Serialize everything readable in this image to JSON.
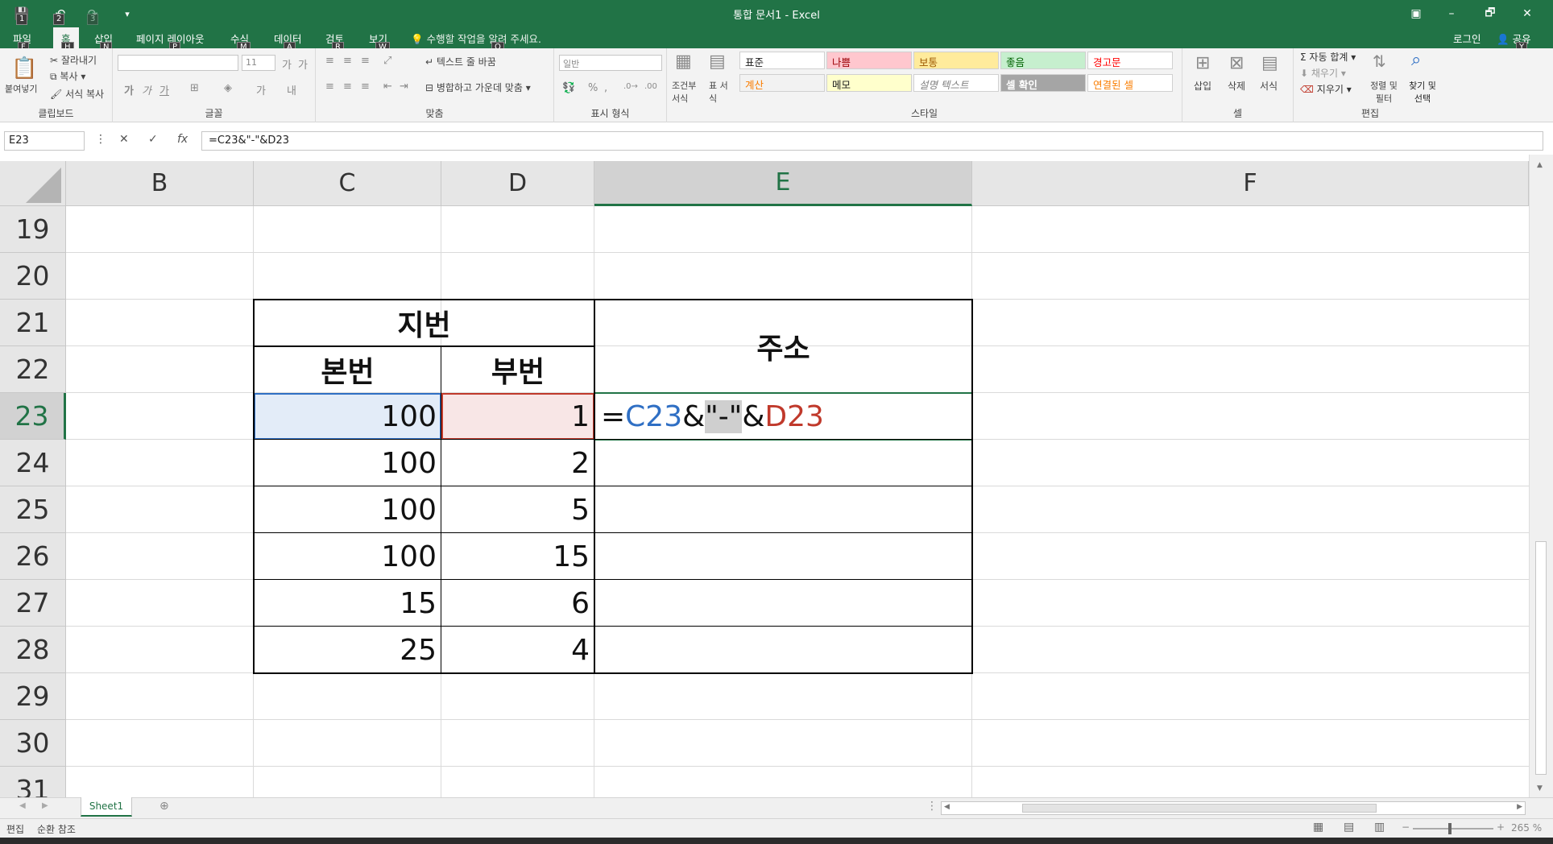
{
  "window": {
    "title": "통합 문서1 - Excel",
    "restore_icon": "▣",
    "minimize": "–",
    "maximize": "🗗",
    "close": "✕"
  },
  "quick_access": {
    "save_icon": "💾",
    "undo_icon": "↶",
    "redo_icon": "↷",
    "customize_icon": "▾",
    "keytips": [
      "1",
      "2",
      "3"
    ]
  },
  "tabs": [
    {
      "label": "파일",
      "keytip": "F"
    },
    {
      "label": "홈",
      "keytip": "H"
    },
    {
      "label": "삽입",
      "keytip": "N"
    },
    {
      "label": "페이지 레이아웃",
      "keytip": "P"
    },
    {
      "label": "수식",
      "keytip": "M"
    },
    {
      "label": "데이터",
      "keytip": "A"
    },
    {
      "label": "검토",
      "keytip": "R"
    },
    {
      "label": "보기",
      "keytip": "W"
    }
  ],
  "tell_me": "수행할 작업을 알려 주세요.",
  "tell_me_keytip": "Q",
  "login": "로그인",
  "share": "공유",
  "share_keytip": "Y",
  "ribbon": {
    "clipboard": {
      "paste": "붙여넣기",
      "cut": "잘라내기",
      "copy": "복사",
      "format_painter": "서식 복사",
      "label": "클립보드"
    },
    "font": {
      "name": "",
      "size": "11",
      "label": "글꼴",
      "bold": "가",
      "italic": "가",
      "underline": "가"
    },
    "alignment": {
      "wrap_text": "텍스트 줄 바꿈",
      "merge_center": "병합하고 가운데 맞춤",
      "label": "맞춤"
    },
    "number": {
      "format": "일반",
      "label": "표시 형식"
    },
    "styles": {
      "conditional": "조건부 서식",
      "table": "표 서식",
      "label": "스타일",
      "cells": [
        {
          "label": "표준",
          "bg": "#ffffff",
          "color": "#222222"
        },
        {
          "label": "나쁨",
          "bg": "#ffc7ce",
          "color": "#9c0006"
        },
        {
          "label": "보통",
          "bg": "#ffeb9c",
          "color": "#9c5700"
        },
        {
          "label": "좋음",
          "bg": "#c6efce",
          "color": "#006100"
        },
        {
          "label": "경고문",
          "bg": "#ffffff",
          "color": "#ff0000"
        },
        {
          "label": "계산",
          "bg": "#f2f2f2",
          "color": "#fa7d00"
        },
        {
          "label": "메모",
          "bg": "#ffffcc",
          "color": "#222222"
        },
        {
          "label": "설명 텍스트",
          "bg": "#ffffff",
          "color": "#7f7f7f"
        },
        {
          "label": "셀 확인",
          "bg": "#a5a5a5",
          "color": "#ffffff"
        },
        {
          "label": "연결된 셀",
          "bg": "#ffffff",
          "color": "#fa7d00"
        }
      ]
    },
    "cells": {
      "insert": "삽입",
      "delete": "삭제",
      "format": "서식",
      "label": "셀"
    },
    "editing": {
      "autosum": "자동 합계",
      "fill": "채우기",
      "clear": "지우기",
      "sort_filter": "정렬 및 필터",
      "find_select": "찾기 및 선택",
      "label": "편집"
    }
  },
  "formula_bar": {
    "name_box": "E23",
    "cancel": "✕",
    "enter": "✓",
    "fx": "fx",
    "formula": "=C23&\"-\"&D23"
  },
  "columns": [
    "B",
    "C",
    "D",
    "E",
    "F"
  ],
  "selected_column": "E",
  "rows": [
    "19",
    "20",
    "21",
    "22",
    "23",
    "24",
    "25",
    "26",
    "27",
    "28",
    "29",
    "30",
    "31"
  ],
  "selected_row": "23",
  "table": {
    "header_group": "지번",
    "header_address": "주소",
    "header_main": "본번",
    "header_sub": "부번",
    "main_values": [
      "100",
      "100",
      "100",
      "100",
      "15",
      "25"
    ],
    "sub_values": [
      "1",
      "2",
      "5",
      "15",
      "6",
      "4"
    ]
  },
  "edit_cell": {
    "eq": "=",
    "ref1": "C23",
    "amp1": "&",
    "q1": "\"",
    "dash": "-",
    "q2": "\"",
    "amp2": "&",
    "ref2": "D23",
    "ref1_color": "#2f6fc4",
    "ref2_color": "#c0392b"
  },
  "sheet_tab": "Sheet1",
  "status": {
    "mode": "편집",
    "circular": "순환 참조",
    "zoom": "265 %"
  },
  "colors": {
    "accent": "#217346"
  }
}
